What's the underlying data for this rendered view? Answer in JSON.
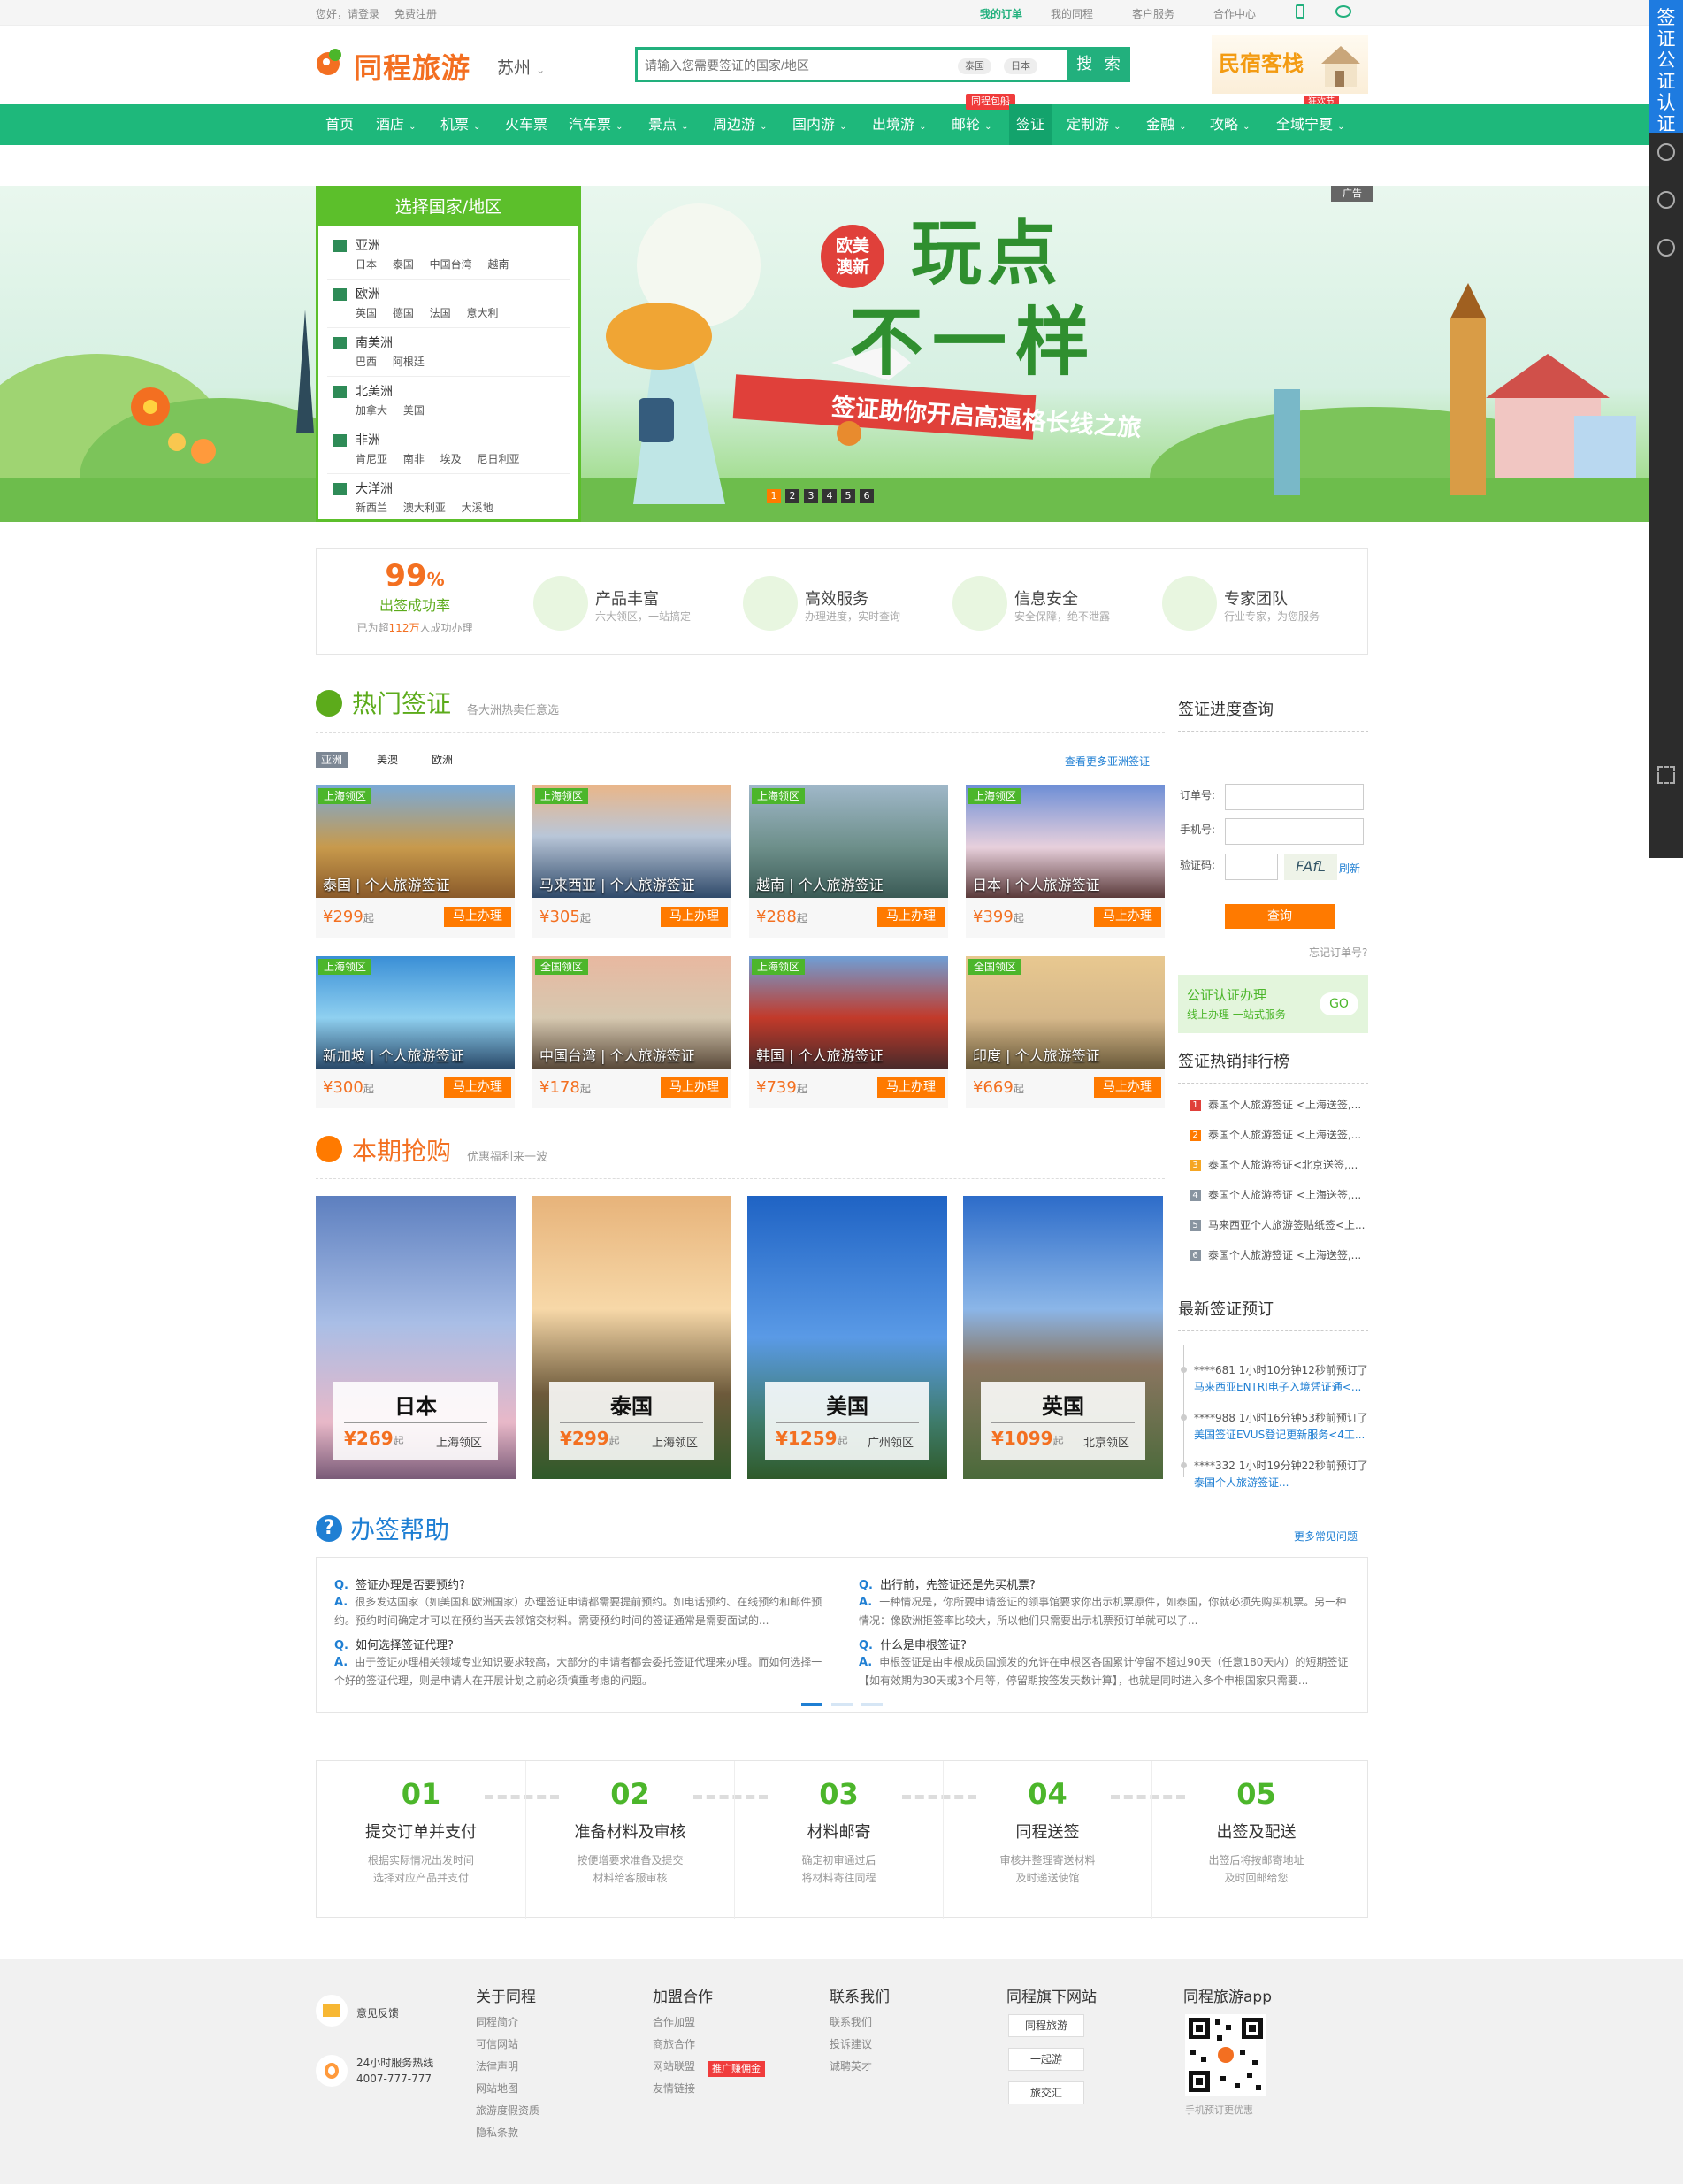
{
  "topbar": {
    "greeting": "您好，请登录",
    "register": "免费注册",
    "my_orders": "我的订单",
    "my_trips": "我的同程",
    "customer_service": "客户服务",
    "partner_center": "合作中心"
  },
  "header": {
    "logo_text": "同程旅游",
    "city": "苏州",
    "search_placeholder": "请输入您需要签证的国家/地区",
    "search_chips": [
      "泰国",
      "日本"
    ],
    "search_button": "搜 索",
    "promo_text": "民宿客栈",
    "promo_badge": "狂欢节"
  },
  "nav": {
    "items": [
      "首页",
      "酒店",
      "机票",
      "火车票",
      "汽车票",
      "景点",
      "周边游",
      "国内游",
      "出境游",
      "邮轮",
      "签证",
      "定制游",
      "金融",
      "攻略",
      "全域宁夏"
    ],
    "active": "签证",
    "badge": "同程包船"
  },
  "banner": {
    "country_box_title": "选择国家/地区",
    "regions": [
      {
        "name": "亚洲",
        "countries": "日本 泰国 中国台湾 越南"
      },
      {
        "name": "欧洲",
        "countries": "英国 德国 法国 意大利"
      },
      {
        "name": "南美洲",
        "countries": "巴西 阿根廷"
      },
      {
        "name": "北美洲",
        "countries": "加拿大 美国"
      },
      {
        "name": "非洲",
        "countries": "肯尼亚 南非 埃及 尼日利亚"
      },
      {
        "name": "大洋洲",
        "countries": "新西兰 澳大利亚 大溪地"
      }
    ],
    "badge_line1": "欧美",
    "badge_line2": "澳新",
    "headline1": "玩点",
    "headline2": "不一样",
    "ribbon": "签证助你开启高逼格长线之旅",
    "ad_tag": "广告",
    "dots": [
      "1",
      "2",
      "3",
      "4",
      "5",
      "6"
    ]
  },
  "features": {
    "rate": "99",
    "rate_unit": "%",
    "rate_label": "出签成功率",
    "rate_note_pre": "已为超",
    "rate_note_num": "112万",
    "rate_note_post": "人成功办理",
    "items": [
      {
        "title": "产品丰富",
        "desc": "六大领区，一站搞定"
      },
      {
        "title": "高效服务",
        "desc": "办理进度，实时查询"
      },
      {
        "title": "信息安全",
        "desc": "安全保障，绝不泄露"
      },
      {
        "title": "专家团队",
        "desc": "行业专家，为您服务"
      }
    ]
  },
  "hot_visa": {
    "title": "热门签证",
    "subtitle": "各大洲热卖任意选",
    "tabs": [
      "亚洲",
      "美澳",
      "欧洲"
    ],
    "more": "查看更多亚洲签证",
    "cards": [
      {
        "badge": "上海领区",
        "name": "泰国 | 个人旅游签证",
        "price": "¥299",
        "suffix": "起",
        "button": "马上办理"
      },
      {
        "badge": "上海领区",
        "name": "马来西亚 | 个人旅游签证",
        "price": "¥305",
        "suffix": "起",
        "button": "马上办理"
      },
      {
        "badge": "上海领区",
        "name": "越南 | 个人旅游签证",
        "price": "¥288",
        "suffix": "起",
        "button": "马上办理"
      },
      {
        "badge": "上海领区",
        "name": "日本 | 个人旅游签证",
        "price": "¥399",
        "suffix": "起",
        "button": "马上办理"
      },
      {
        "badge": "上海领区",
        "name": "新加坡 | 个人旅游签证",
        "price": "¥300",
        "suffix": "起",
        "button": "马上办理"
      },
      {
        "badge": "全国领区",
        "name": "中国台湾 | 个人旅游签证",
        "price": "¥178",
        "suffix": "起",
        "button": "马上办理"
      },
      {
        "badge": "上海领区",
        "name": "韩国 | 个人旅游签证",
        "price": "¥739",
        "suffix": "起",
        "button": "马上办理"
      },
      {
        "badge": "全国领区",
        "name": "印度 | 个人旅游签证",
        "price": "¥669",
        "suffix": "起",
        "button": "马上办理"
      }
    ]
  },
  "flash_sale": {
    "title": "本期抢购",
    "subtitle": "优惠福利来一波",
    "cards": [
      {
        "name": "日本",
        "price": "¥269",
        "suffix": "起",
        "region": "上海领区"
      },
      {
        "name": "泰国",
        "price": "¥299",
        "suffix": "起",
        "region": "上海领区"
      },
      {
        "name": "美国",
        "price": "¥1259",
        "suffix": "起",
        "region": "广州领区"
      },
      {
        "name": "英国",
        "price": "¥1099",
        "suffix": "起",
        "region": "北京领区"
      }
    ]
  },
  "sidebar": {
    "query_title": "签证进度查询",
    "order_label": "订单号:",
    "phone_label": "手机号:",
    "captcha_label": "验证码:",
    "captcha_text": "FAfL",
    "refresh": "刷新",
    "query_button": "查询",
    "forgot": "忘记订单号?",
    "notary_title": "公证认证办理",
    "notary_sub": "线上办理  一站式服务",
    "notary_go": "GO",
    "rank_title": "签证热销排行榜",
    "ranks": [
      "泰国个人旅游签证 <上海送签,...",
      "泰国个人旅游签证 <上海送签,...",
      "泰国个人旅游签证<北京送签,...",
      "泰国个人旅游签证 <上海送签,...",
      "马来西亚个人旅游签贴纸签<上...",
      "泰国个人旅游签证 <上海送签,..."
    ],
    "recent_title": "最新签证预订",
    "recent": [
      {
        "who": "****681 1小时10分钟12秒前预订了",
        "what": "马来西亚ENTRI电子入境凭证通<..."
      },
      {
        "who": "****988 1小时16分钟53秒前预订了",
        "what": "美国签证EVUS登记更新服务<4工..."
      },
      {
        "who": "****332 1小时19分钟22秒前预订了",
        "what": "泰国个人旅游签证..."
      }
    ]
  },
  "help": {
    "title": "办签帮助",
    "more": "更多常见问题",
    "qa": [
      {
        "q": "签证办理是否要预约?",
        "a": "很多发达国家（如美国和欧洲国家）办理签证申请都需要提前预约。如电话预约、在线预约和邮件预约。预约时间确定才可以在预约当天去领馆交材料。需要预约时间的签证通常是需要面试的..."
      },
      {
        "q": "如何选择签证代理?",
        "a": "由于签证办理相关领域专业知识要求较高，大部分的申请者都会委托签证代理来办理。而如何选择一个好的签证代理，则是申请人在开展计划之前必须慎重考虑的问题。"
      },
      {
        "q": "出行前，先签证还是先买机票?",
        "a": "一种情况是，你所要申请签证的领事馆要求你出示机票原件，如泰国，你就必须先购买机票。另一种情况：像欧洲拒签率比较大，所以他们只需要出示机票预订单就可以了..."
      },
      {
        "q": "什么是申根签证?",
        "a": "申根签证是由申根成员国颁发的允许在申根区各国累计停留不超过90天（任意180天内）的短期签证【如有效期为30天或3个月等，停留期按签发天数计算】，也就是同时进入多个申根国家只需要..."
      }
    ],
    "q_mark": "Q.",
    "a_mark": "A."
  },
  "steps": [
    {
      "num": "01",
      "title": "提交订单并支付",
      "desc1": "根据实际情况出发时间",
      "desc2": "选择对应产品并支付"
    },
    {
      "num": "02",
      "title": "准备材料及审核",
      "desc1": "按便增要求准备及提交",
      "desc2": "材料给客服审核"
    },
    {
      "num": "03",
      "title": "材料邮寄",
      "desc1": "确定初审通过后",
      "desc2": "将材料寄往同程"
    },
    {
      "num": "04",
      "title": "同程送签",
      "desc1": "审核并整理寄送材料",
      "desc2": "及时递送使馆"
    },
    {
      "num": "05",
      "title": "出签及配送",
      "desc1": "出签后将按邮寄地址",
      "desc2": "及时回邮给您"
    }
  ],
  "footer": {
    "feedback": "意见反馈",
    "hotline_label": "24小时服务热线",
    "hotline": "4007-777-777",
    "about_title": "关于同程",
    "about_links": [
      "同程简介",
      "可信网站",
      "法律声明",
      "网站地图",
      "旅游度假资质",
      "隐私条款"
    ],
    "join_title": "加盟合作",
    "join_links": [
      "合作加盟",
      "商旅合作",
      "网站联盟",
      "友情链接"
    ],
    "join_badge": "推广赚佣金",
    "contact_title": "联系我们",
    "contact_links": [
      "联系我们",
      "投诉建议",
      "诚聘英才"
    ],
    "sites_title": "同程旗下网站",
    "sites": [
      "同程旅游",
      "一起游",
      "旅交汇"
    ],
    "app_title": "同程旅游app",
    "app_note": "手机预订更优惠"
  },
  "right_sidebar": {
    "cert": "签证公证认证"
  },
  "colors": {
    "brand_green": "#1eb87b",
    "accent_orange": "#ff7a00",
    "title_green": "#5cab1b",
    "help_blue": "#1f7fd3"
  }
}
